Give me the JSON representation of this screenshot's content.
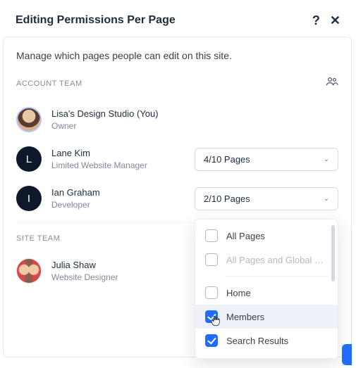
{
  "header": {
    "title": "Editing Permissions Per Page"
  },
  "intro": "Manage which pages people can edit on this site.",
  "sections": {
    "account_team": "ACCOUNT TEAM",
    "site_team": "SITE TEAM"
  },
  "account_members": [
    {
      "name": "Lisa's Design Studio (You)",
      "role": "Owner",
      "avatar_initial": ""
    },
    {
      "name": "Lane Kim",
      "role": "Limited Website Manager",
      "avatar_initial": "L",
      "pages_label": "4/10 Pages"
    },
    {
      "name": "Ian Graham",
      "role": "Developer",
      "avatar_initial": "I",
      "pages_label": "2/10 Pages"
    }
  ],
  "site_members": [
    {
      "name": "Julia Shaw",
      "role": "Website Designer"
    }
  ],
  "dropdown": {
    "items": [
      {
        "label": "All Pages",
        "checked": false,
        "disabled": false
      },
      {
        "label": "All Pages and Global Se…",
        "checked": false,
        "disabled": true
      },
      {
        "label": "Home",
        "checked": false,
        "disabled": false
      },
      {
        "label": "Members",
        "checked": true,
        "disabled": false,
        "highlight": true
      },
      {
        "label": "Search Results",
        "checked": true,
        "disabled": false
      }
    ]
  },
  "icons": {
    "help": "?",
    "close": "✕",
    "people": "👥"
  }
}
